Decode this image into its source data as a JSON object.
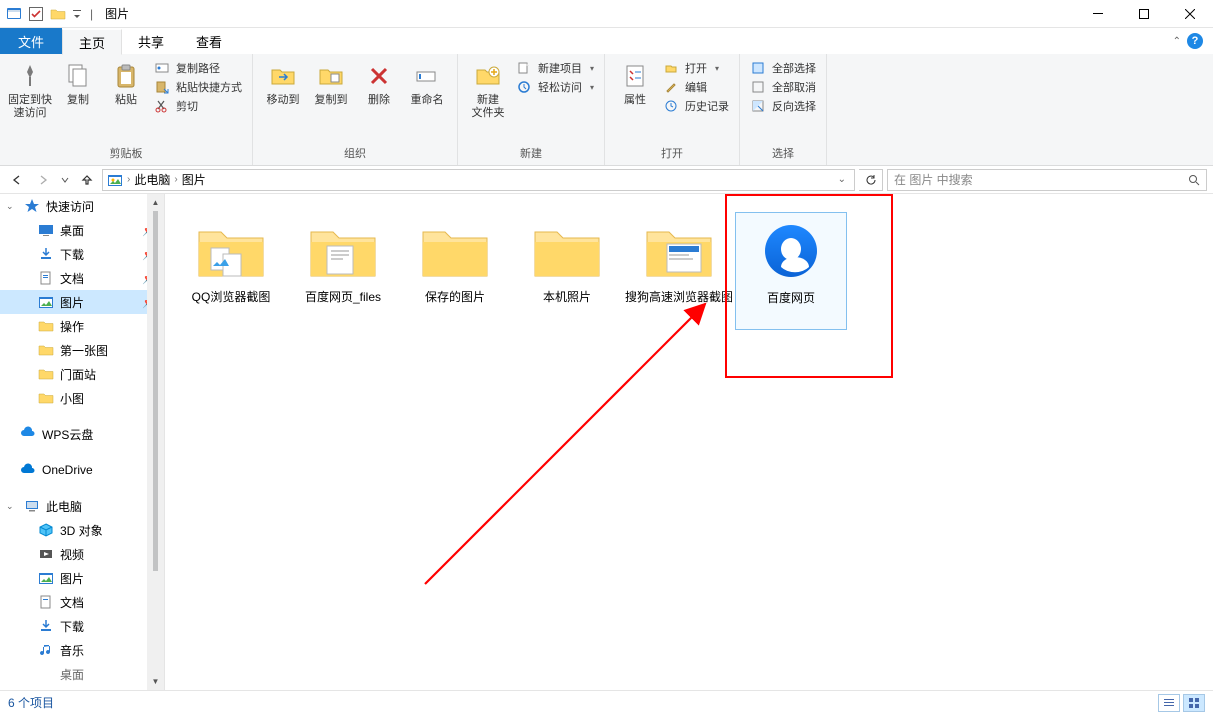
{
  "window": {
    "title": "图片",
    "separator": "|"
  },
  "tabs": {
    "file": "文件",
    "items": [
      "主页",
      "共享",
      "查看"
    ],
    "active_index": 0
  },
  "ribbon": {
    "groups": [
      {
        "name": "剪贴板",
        "big": [
          {
            "id": "pin-quick",
            "label": "固定到快\n速访问"
          },
          {
            "id": "copy",
            "label": "复制"
          },
          {
            "id": "paste",
            "label": "粘贴"
          }
        ],
        "mini": [
          {
            "id": "copy-path",
            "label": "复制路径"
          },
          {
            "id": "paste-shortcut",
            "label": "粘贴快捷方式"
          },
          {
            "id": "cut",
            "label": "剪切"
          }
        ]
      },
      {
        "name": "组织",
        "big": [
          {
            "id": "move-to",
            "label": "移动到"
          },
          {
            "id": "copy-to",
            "label": "复制到"
          },
          {
            "id": "delete",
            "label": "删除"
          },
          {
            "id": "rename",
            "label": "重命名"
          }
        ],
        "mini": []
      },
      {
        "name": "新建",
        "big": [
          {
            "id": "new-folder",
            "label": "新建\n文件夹"
          }
        ],
        "mini": [
          {
            "id": "new-item",
            "label": "新建项目"
          },
          {
            "id": "easy-access",
            "label": "轻松访问"
          }
        ]
      },
      {
        "name": "打开",
        "big": [
          {
            "id": "properties",
            "label": "属性"
          }
        ],
        "mini": [
          {
            "id": "open",
            "label": "打开"
          },
          {
            "id": "edit",
            "label": "编辑"
          },
          {
            "id": "history",
            "label": "历史记录"
          }
        ]
      },
      {
        "name": "选择",
        "big": [],
        "mini": [
          {
            "id": "select-all",
            "label": "全部选择"
          },
          {
            "id": "select-none",
            "label": "全部取消"
          },
          {
            "id": "invert-sel",
            "label": "反向选择"
          }
        ]
      }
    ]
  },
  "address": {
    "crumbs": [
      "此电脑",
      "图片"
    ],
    "search_placeholder": "在 图片 中搜索"
  },
  "nav": {
    "quick_access": "快速访问",
    "items_quick": [
      {
        "id": "desktop",
        "label": "桌面",
        "pinned": true
      },
      {
        "id": "downloads",
        "label": "下载",
        "pinned": true
      },
      {
        "id": "documents",
        "label": "文档",
        "pinned": true
      },
      {
        "id": "pictures",
        "label": "图片",
        "pinned": true,
        "selected": true
      },
      {
        "id": "caozuo",
        "label": "操作",
        "pinned": false
      },
      {
        "id": "diyizhangtu",
        "label": "第一张图",
        "pinned": false
      },
      {
        "id": "menmianzhan",
        "label": "门面站",
        "pinned": false
      },
      {
        "id": "xiaotu",
        "label": "小图",
        "pinned": false
      }
    ],
    "wps": "WPS云盘",
    "onedrive": "OneDrive",
    "this_pc": "此电脑",
    "pc_items": [
      {
        "id": "3d",
        "label": "3D 对象"
      },
      {
        "id": "videos",
        "label": "视频"
      },
      {
        "id": "pictures2",
        "label": "图片"
      },
      {
        "id": "documents2",
        "label": "文档"
      },
      {
        "id": "downloads2",
        "label": "下载"
      },
      {
        "id": "music",
        "label": "音乐"
      },
      {
        "id": "desktop2",
        "label": "桌面"
      }
    ]
  },
  "content": {
    "items": [
      {
        "id": "qq-screenshots",
        "label": "QQ浏览器截图",
        "type": "folder"
      },
      {
        "id": "baidu-files",
        "label": "百度网页_files",
        "type": "folder"
      },
      {
        "id": "saved-pictures",
        "label": "保存的图片",
        "type": "folder"
      },
      {
        "id": "camera-roll",
        "label": "本机照片",
        "type": "folder"
      },
      {
        "id": "sogou-screenshots",
        "label": "搜狗高速浏览器截图",
        "type": "folder"
      },
      {
        "id": "baidu-html",
        "label": "百度网页",
        "type": "html"
      }
    ]
  },
  "status": {
    "text": "6 个项目"
  }
}
